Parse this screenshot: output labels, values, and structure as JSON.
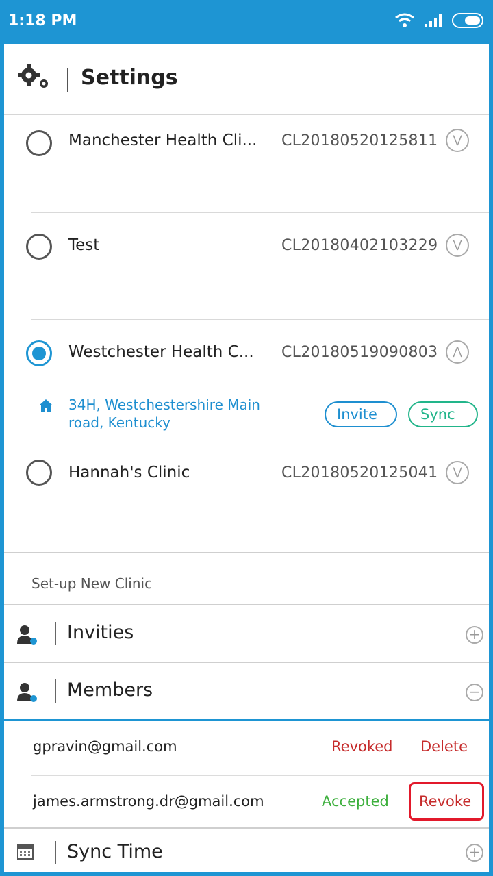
{
  "status_bar": {
    "time": "1:18 PM"
  },
  "header": {
    "title": "Settings"
  },
  "clinics": [
    {
      "name": "Manchester Health Cli...",
      "code": "CL20180520125811",
      "selected": false
    },
    {
      "name": "Test",
      "code": "CL20180402103229",
      "selected": false
    },
    {
      "name": "Westchester Health C...",
      "code": "CL20180519090803",
      "selected": true,
      "address_line1": "34H, Westchestershire Main",
      "address_line2": "road, Kentucky",
      "invite_label": "Invite",
      "sync_label": "Sync"
    },
    {
      "name": "Hannah's Clinic",
      "code": "CL20180520125041",
      "selected": false
    }
  ],
  "setup_label": "Set-up New Clinic",
  "sections": {
    "invities": "Invities",
    "members": "Members",
    "sync_time": "Sync Time"
  },
  "members": [
    {
      "email": "gpravin@gmail.com",
      "status": "Revoked",
      "action": "Delete"
    },
    {
      "email": "james.armstrong.dr@gmail.com",
      "status": "Accepted",
      "action": "Revoke"
    }
  ],
  "colors": {
    "accent": "#1e95d3",
    "danger": "#c62b2b",
    "success": "#3caf3c",
    "sync": "#22b58a"
  }
}
